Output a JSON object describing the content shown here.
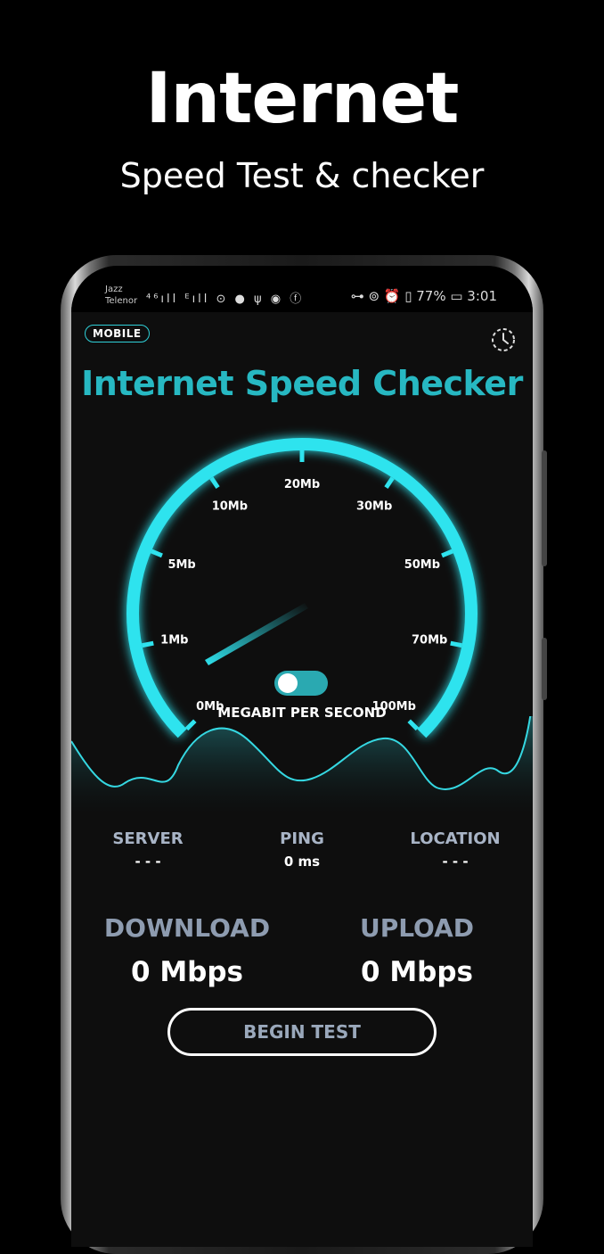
{
  "promo": {
    "title": "Internet",
    "subtitle": "Speed Test & checker"
  },
  "status_bar": {
    "carrier_1": "Jazz",
    "carrier_2": "Telenor",
    "left_icons": "⁴⁶ıll ᴱıll ⊙ ● ψ ◉ ⓕ",
    "right_text": "⊶ ⊚ ⏰ ▯ 77% ▭ 3:01"
  },
  "app": {
    "network_badge": "MOBILE",
    "title": "Internet Speed Checker",
    "history_icon": "history-clock-icon"
  },
  "gauge": {
    "labels": [
      "0Mb",
      "1Mb",
      "5Mb",
      "10Mb",
      "20Mb",
      "30Mb",
      "50Mb",
      "70Mb",
      "100Mb"
    ],
    "needle_value": "0Mb",
    "unit_label": "MEGABIT PER SECOND",
    "accent_color": "#2fe3ee"
  },
  "toggle": {
    "on": true
  },
  "info": {
    "server_label": "SERVER",
    "server_value": "- - -",
    "ping_label": "PING",
    "ping_value": "0 ms",
    "location_label": "LOCATION",
    "location_value": "- - -"
  },
  "results": {
    "download_label": "DOWNLOAD",
    "download_value": "0 Mbps",
    "upload_label": "UPLOAD",
    "upload_value": "0 Mbps"
  },
  "actions": {
    "begin_test_label": "BEGIN TEST"
  }
}
